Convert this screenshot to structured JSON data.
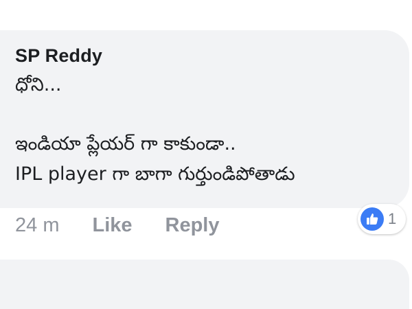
{
  "comment": {
    "author": "SP Reddy",
    "lines": [
      "ధోని...",
      "ఇండియా ప్లేయర్ గా కాకుండా..",
      "IPL player గా బాగా గుర్తుండిపోతాడు"
    ],
    "timestamp": "24 m",
    "like_label": "Like",
    "reply_label": "Reply",
    "reaction": {
      "icon": "thumbs-up-icon",
      "count": "1",
      "color": "#3b7cf5"
    }
  }
}
